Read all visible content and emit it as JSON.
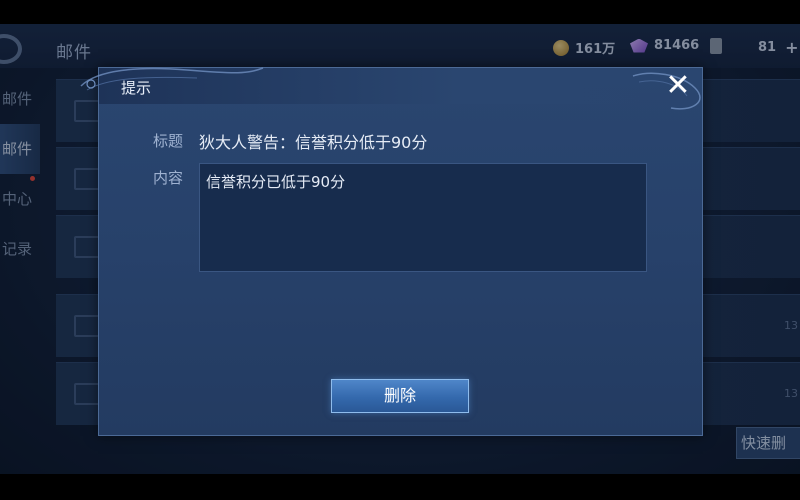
{
  "header": {
    "title": "邮件",
    "gold": "161万",
    "gems": "81466",
    "scrolls": "81",
    "plus_label": "+"
  },
  "sidebar": {
    "items": [
      {
        "label": "邮件"
      },
      {
        "label": "邮件"
      },
      {
        "label": "中心"
      },
      {
        "label": "记录"
      }
    ]
  },
  "mail_list": {
    "times": [
      "",
      "",
      "",
      "13",
      "13"
    ],
    "quick_delete_label": "快速删"
  },
  "dialog": {
    "title": "提示",
    "close_glyph": "✕",
    "subject_label": "标题",
    "subject_value": "狄大人警告：信誉积分低于90分",
    "content_label": "内容",
    "content_value": "信誉积分已低于90分",
    "delete_label": "删除"
  },
  "colors": {
    "accent_button": "#3a70b5",
    "panel": "#27416a",
    "notification_dot": "#e0463a"
  },
  "icons": [
    "logo-ring-icon",
    "gold-coin-icon",
    "gem-icon",
    "scroll-icon",
    "plus-icon",
    "envelope-icon",
    "close-icon",
    "swirl-ornament-icon"
  ]
}
